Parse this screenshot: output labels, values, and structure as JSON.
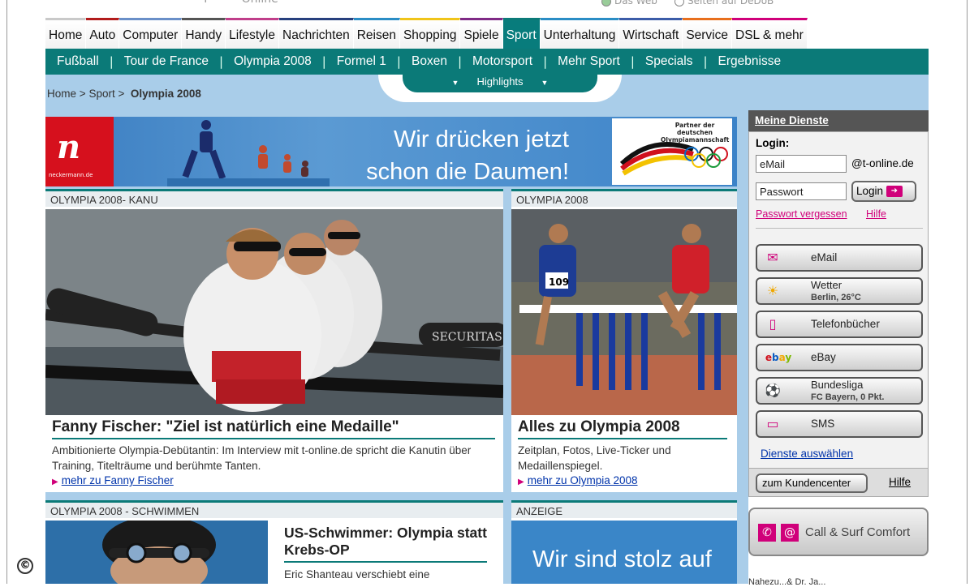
{
  "top": {
    "option1": "Das Web",
    "option2": "Seiten auf DeDoB"
  },
  "nav": {
    "items": [
      "Home",
      "Auto",
      "Computer",
      "Handy",
      "Lifestyle",
      "Nachrichten",
      "Reisen",
      "Shopping",
      "Spiele",
      "Sport",
      "Unterhaltung",
      "Wirtschaft",
      "Service",
      "DSL & mehr"
    ],
    "active": "Sport",
    "colors": [
      "#c9c9c9",
      "#b21c1c",
      "#6a8fc8",
      "#555555",
      "#c03e8a",
      "#27407e",
      "#2a8dc5",
      "#f0c419",
      "#7f2a86",
      "#0b7a78",
      "#2a8dc5",
      "#3b5ca8",
      "#e86f1d",
      "#d0007a"
    ]
  },
  "subnav": {
    "items": [
      "Fußball",
      "Tour de France",
      "Olympia 2008",
      "Formel 1",
      "Boxen",
      "Motorsport",
      "Mehr Sport",
      "Specials",
      "Ergebnisse"
    ]
  },
  "highlights": {
    "label": "Highlights"
  },
  "breadcrumb": {
    "home": "Home",
    "sport": "Sport",
    "current": "Olympia 2008",
    "sep": ">"
  },
  "banner": {
    "logo_text": "neckermann.de",
    "slogan_line1": "Wir drücken jetzt",
    "slogan_line2": "schon die Daumen!",
    "partner_text": "Partner der deutschen Olympiamannschaft"
  },
  "panels": {
    "kanu": {
      "header": "OLYMPIA 2008- KANU",
      "headline": "Fanny Fischer: \"Ziel ist natürlich eine Medaille\"",
      "teaser": "Ambitionierte Olympia-Debütantin: Im Interview mit t-online.de spricht die Kanutin über Training, Titelträume und berühmte Tanten.",
      "more": "mehr zu Fanny Fischer"
    },
    "olympia": {
      "header": "OLYMPIA 2008",
      "headline": "Alles zu Olympia 2008",
      "teaser": "Zeitplan, Fotos, Live-Ticker und Medaillenspiegel.",
      "more": "mehr zu Olympia 2008"
    },
    "schwimmen": {
      "header": "OLYMPIA 2008 - SCHWIMMEN",
      "headline": "US-Schwimmer: Olympia statt Krebs-OP",
      "teaser": "Eric Shanteau verschiebt eine"
    },
    "anzeige": {
      "header": "ANZEIGE",
      "text": "Wir sind stolz auf"
    }
  },
  "sidebar": {
    "title": "Meine Dienste",
    "login_label": "Login:",
    "email_value": "eMail",
    "domain": "@t-online.de",
    "password_value": "Passwort",
    "login_button": "Login",
    "forgot": "Passwort vergessen",
    "help": "Hilfe",
    "services": [
      {
        "label": "eMail",
        "icon": "email-icon"
      },
      {
        "label": "Wetter",
        "sub": "Berlin, 26°C",
        "icon": "weather-icon"
      },
      {
        "label": "Telefonbücher",
        "icon": "phonebook-icon"
      },
      {
        "label": "eBay",
        "icon": "ebay-icon"
      },
      {
        "label": "Bundesliga",
        "sub": "FC Bayern, 0 Pkt.",
        "icon": "football-icon"
      },
      {
        "label": "SMS",
        "icon": "sms-icon"
      }
    ],
    "choose": "Dienste auswählen",
    "kundencenter": "zum Kundencenter",
    "help2": "Hilfe",
    "comfort": "Call & Surf Comfort",
    "cut_text": "Nahezu...& Dr. Ja..."
  },
  "copyright": "©"
}
